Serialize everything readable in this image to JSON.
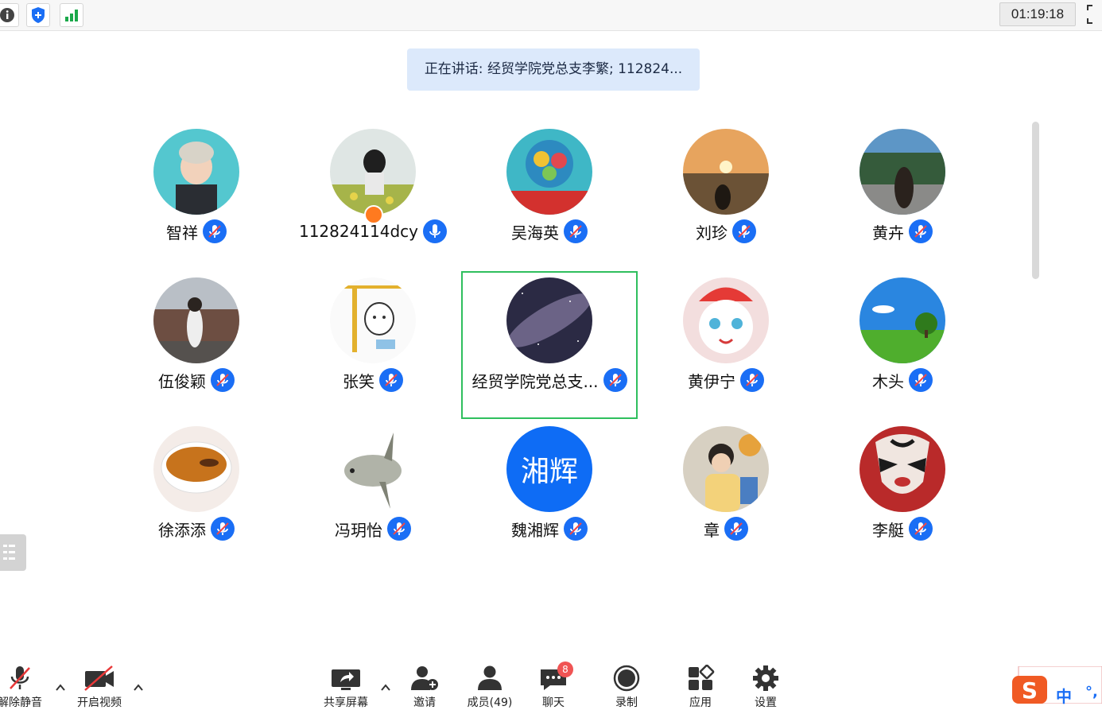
{
  "topbar": {
    "icons": [
      "info-icon",
      "security-shield-icon",
      "signal-icon"
    ],
    "timer": "01:19:18"
  },
  "speaking_banner": "正在讲话: 经贸学院党总支李繁; 112824...",
  "participants": [
    {
      "name": "智祥",
      "mic": "muted"
    },
    {
      "name": "112824114dcy",
      "mic": "unmuted",
      "host": true
    },
    {
      "name": "吴海英",
      "mic": "muted"
    },
    {
      "name": "刘珍",
      "mic": "muted"
    },
    {
      "name": "黄卉",
      "mic": "muted"
    },
    {
      "name": "伍俊颖",
      "mic": "muted"
    },
    {
      "name": "张笑",
      "mic": "muted"
    },
    {
      "name": "经贸学院党总支...",
      "mic": "muted",
      "active": true
    },
    {
      "name": "黄伊宁",
      "mic": "muted"
    },
    {
      "name": "木头",
      "mic": "muted"
    },
    {
      "name": "徐添添",
      "mic": "muted"
    },
    {
      "name": "冯玥怡",
      "mic": "muted"
    },
    {
      "name": "魏湘辉",
      "mic": "muted",
      "avatar_text": "湘辉"
    },
    {
      "name": "章",
      "mic": "muted"
    },
    {
      "name": "李艇",
      "mic": "muted"
    }
  ],
  "toolbar": {
    "unmute": "解除静音",
    "start_video": "开启视频",
    "share_screen": "共享屏幕",
    "invite": "邀请",
    "members": "成员(49)",
    "chat": "聊天",
    "chat_badge": "8",
    "record": "录制",
    "apps": "应用",
    "settings": "设置"
  },
  "ime": {
    "mode": "中",
    "punct": "°,"
  },
  "colors": {
    "accent": "#1a6ef5",
    "active_border": "#2fbf5e",
    "banner_bg": "#dce9fb",
    "badge": "#f05454"
  }
}
